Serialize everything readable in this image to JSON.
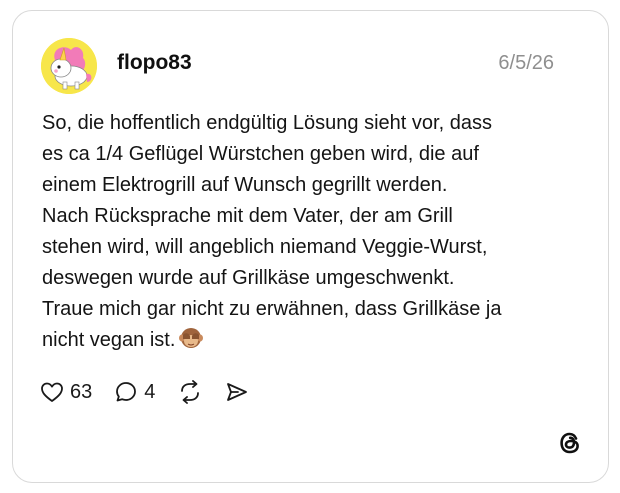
{
  "post": {
    "username": "flopo83",
    "date": "6/5/26",
    "avatar_icon": "unicorn-avatar-icon",
    "lines": [
      "So, die hoffentlich endgültig Lösung sieht vor, dass",
      "es ca 1/4 Geflügel Würstchen geben wird, die auf",
      "einem Elektrogrill auf Wunsch gegrillt werden.",
      "Nach Rücksprache mit dem Vater, der am Grill",
      "stehen wird, will angeblich niemand Veggie-Wurst,",
      "deswegen wurde auf Grillkäse umgeschwenkt.",
      "Traue mich gar nicht zu erwähnen, dass Grillkäse ja",
      "nicht vegan ist."
    ],
    "trailing_emoji": "see-no-evil-monkey-icon"
  },
  "actions": {
    "likes": "63",
    "replies": "4",
    "like_icon": "heart-icon",
    "reply_icon": "speech-bubble-icon",
    "repost_icon": "repost-icon",
    "share_icon": "send-icon"
  },
  "brand": {
    "logo": "threads-logo-icon"
  },
  "colors": {
    "border": "#d9d9d9",
    "date": "#8f8f8f",
    "avatar_bg": "#f7e64a"
  }
}
